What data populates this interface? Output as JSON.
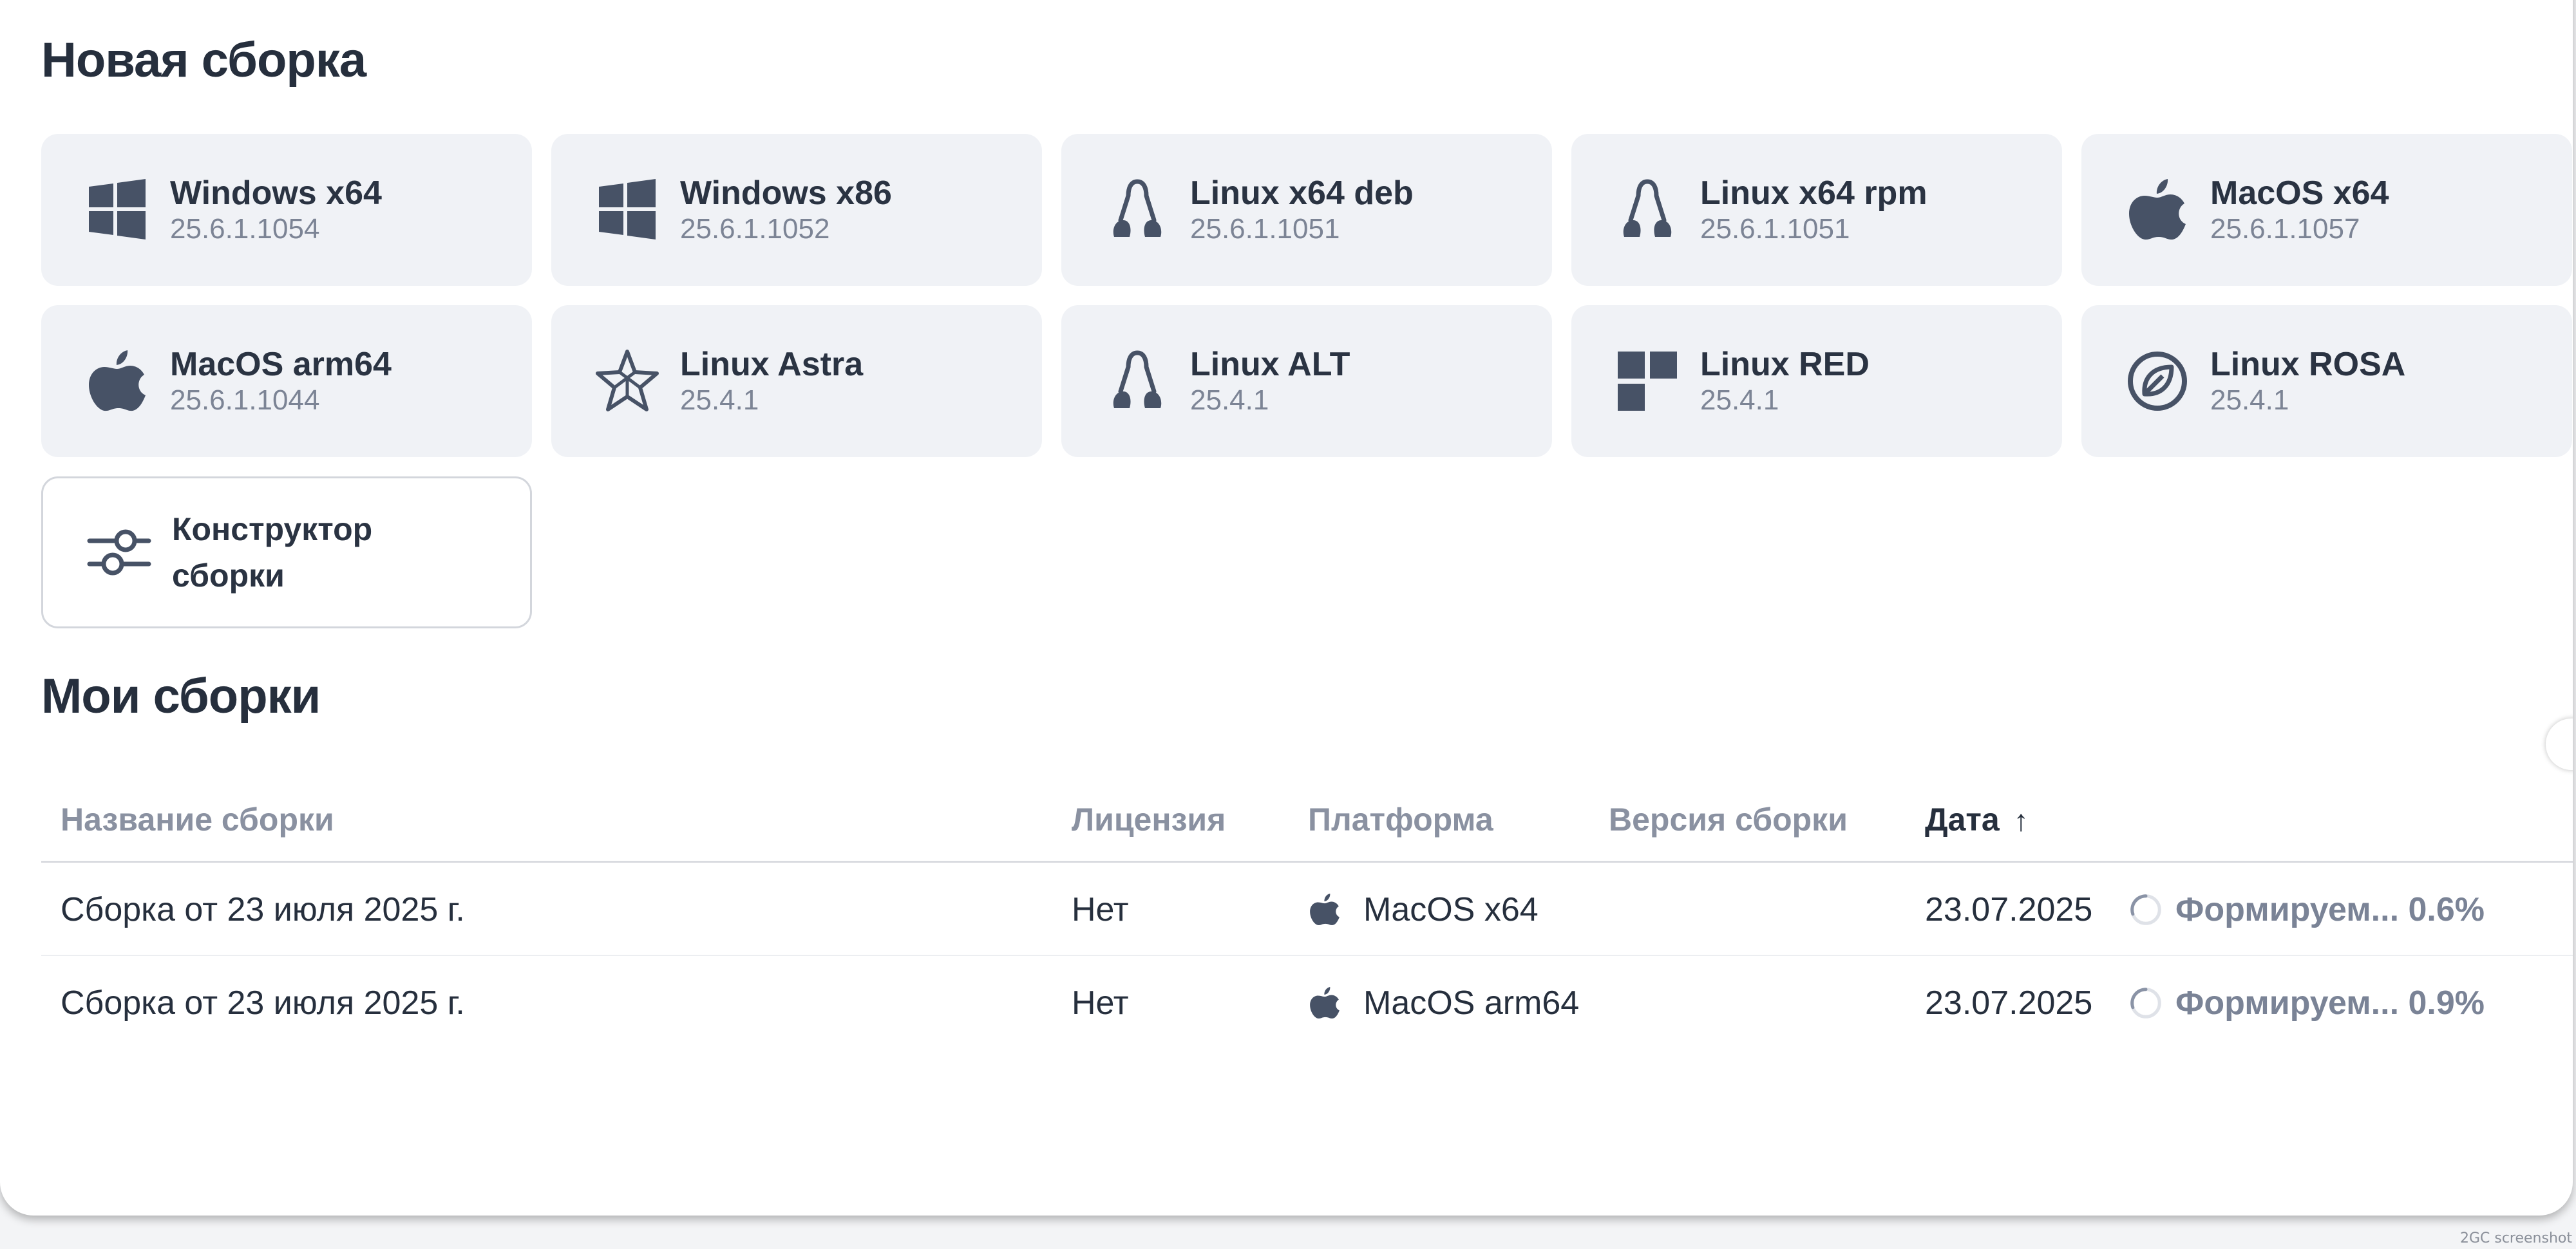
{
  "new_build": {
    "title": "Новая сборка",
    "platforms": [
      {
        "name": "Windows x64",
        "version": "25.6.1.1054",
        "icon": "windows-icon"
      },
      {
        "name": "Windows x86",
        "version": "25.6.1.1052",
        "icon": "windows-icon"
      },
      {
        "name": "Linux x64 deb",
        "version": "25.6.1.1051",
        "icon": "linux-icon"
      },
      {
        "name": "Linux x64 rpm",
        "version": "25.6.1.1051",
        "icon": "linux-icon"
      },
      {
        "name": "MacOS x64",
        "version": "25.6.1.1057",
        "icon": "apple-icon"
      },
      {
        "name": "MacOS arm64",
        "version": "25.6.1.1044",
        "icon": "apple-icon"
      },
      {
        "name": "Linux Astra",
        "version": "25.4.1",
        "icon": "astra-star-icon"
      },
      {
        "name": "Linux ALT",
        "version": "25.4.1",
        "icon": "linux-icon"
      },
      {
        "name": "Linux RED",
        "version": "25.4.1",
        "icon": "red-os-icon"
      },
      {
        "name": "Linux ROSA",
        "version": "25.4.1",
        "icon": "rosa-icon"
      }
    ],
    "builder": {
      "line1": "Конструктор",
      "line2": "сборки",
      "icon": "sliders-icon"
    }
  },
  "my_builds": {
    "title": "Мои сборки",
    "columns": {
      "name": "Название сборки",
      "license": "Лицензия",
      "platform": "Платформа",
      "version": "Версия сборки",
      "date": "Дата",
      "date_sort": "↑"
    },
    "rows": [
      {
        "name": "Сборка от 23 июля 2025 г.",
        "license": "Нет",
        "platform": "MacOS x64",
        "platform_icon": "apple-icon",
        "version": "",
        "date": "23.07.2025",
        "status": "Формируем...",
        "progress": "0.6%"
      },
      {
        "name": "Сборка от 23 июля 2025 г.",
        "license": "Нет",
        "platform": "MacOS arm64",
        "platform_icon": "apple-icon",
        "version": "",
        "date": "23.07.2025",
        "status": "Формируем...",
        "progress": "0.9%"
      }
    ]
  },
  "colors": {
    "icon": "#475266",
    "card_bg": "#f0f2f6",
    "muted": "#8a91a1",
    "text": "#262f3d"
  },
  "watermark": "2GC screenshot"
}
